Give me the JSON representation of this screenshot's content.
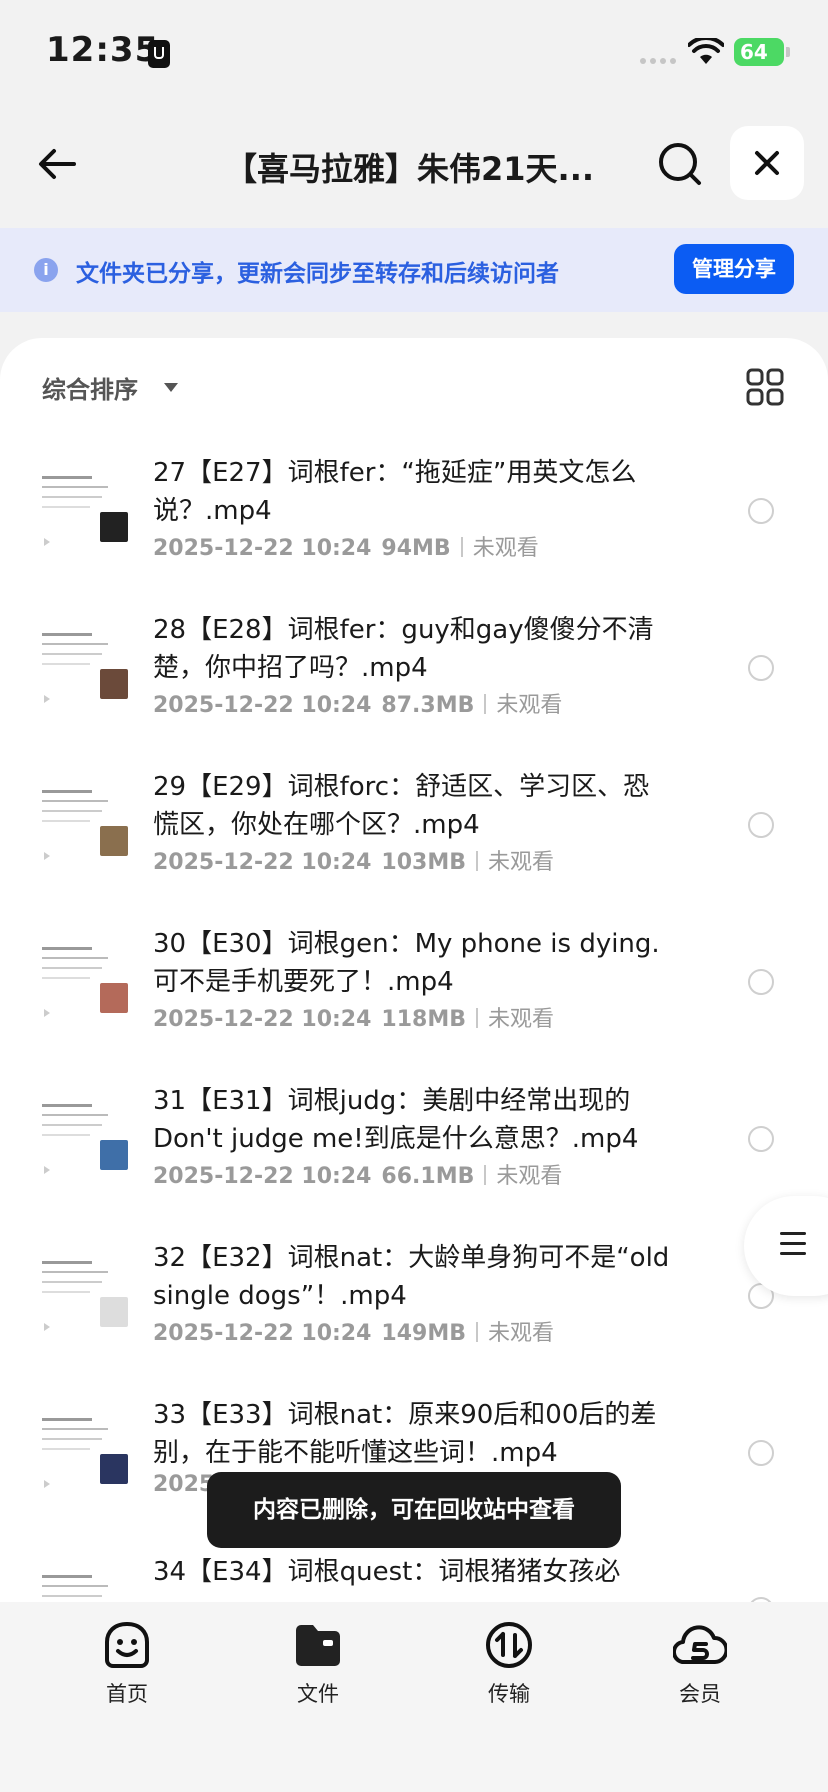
{
  "status_bar": {
    "time": "12:35",
    "battery": "64"
  },
  "header": {
    "title": "【喜马拉雅】朱伟21天..."
  },
  "notice": {
    "text": "文件夹已分享，更新会同步至转存和后续访问者",
    "button": "管理分享"
  },
  "toolbar": {
    "sort_label": "综合排序"
  },
  "files": [
    {
      "name": "27【E27】词根fer：“拖延症”用英文怎么说？.mp4",
      "date": "2025-12-22 10:24",
      "size": "94MB",
      "status": "未观看",
      "thumb_color": "#222222"
    },
    {
      "name": "28【E28】词根fer：guy和gay傻傻分不清楚，你中招了吗？.mp4",
      "date": "2025-12-22 10:24",
      "size": "87.3MB",
      "status": "未观看",
      "thumb_color": "#6b4a3a"
    },
    {
      "name": "29【E29】词根forc：舒适区、学习区、恐慌区，你处在哪个区？.mp4",
      "date": "2025-12-22 10:24",
      "size": "103MB",
      "status": "未观看",
      "thumb_color": "#8a6f4e"
    },
    {
      "name": "30【E30】词根gen：My phone is dying.可不是手机要死了！.mp4",
      "date": "2025-12-22 10:24",
      "size": "118MB",
      "status": "未观看",
      "thumb_color": "#b46a5a"
    },
    {
      "name": "31【E31】词根judg：美剧中经常出现的Don't judge me!到底是什么意思？.mp4",
      "date": "2025-12-22 10:24",
      "size": "66.1MB",
      "status": "未观看",
      "thumb_color": "#3f6fa8"
    },
    {
      "name": "32【E32】词根nat：大龄单身狗可不是“old single dogs”！.mp4",
      "date": "2025-12-22 10:24",
      "size": "149MB",
      "status": "未观看",
      "thumb_color": "#dddddd"
    },
    {
      "name": "33【E33】词根nat：原来90后和00后的差别，在于能不能听懂这些词！.mp4",
      "date": "2025-12-22 10:24",
      "size": "",
      "status": "",
      "thumb_color": "#2a3560"
    },
    {
      "name": "34【E34】词根quest：词根猪猪女孩必",
      "date": "",
      "size": "",
      "status": "",
      "thumb_color": "#cccccc"
    }
  ],
  "toast": "内容已删除，可在回收站中查看",
  "tabs": [
    {
      "label": "首页",
      "icon": "home-face-icon"
    },
    {
      "label": "文件",
      "icon": "folder-icon"
    },
    {
      "label": "传输",
      "icon": "transfer-icon"
    },
    {
      "label": "会员",
      "icon": "vip-cloud-icon"
    }
  ],
  "colors": {
    "accent": "#0b5cf3",
    "notice_bg": "#e7eafa",
    "notice_text": "#2b60e0"
  }
}
